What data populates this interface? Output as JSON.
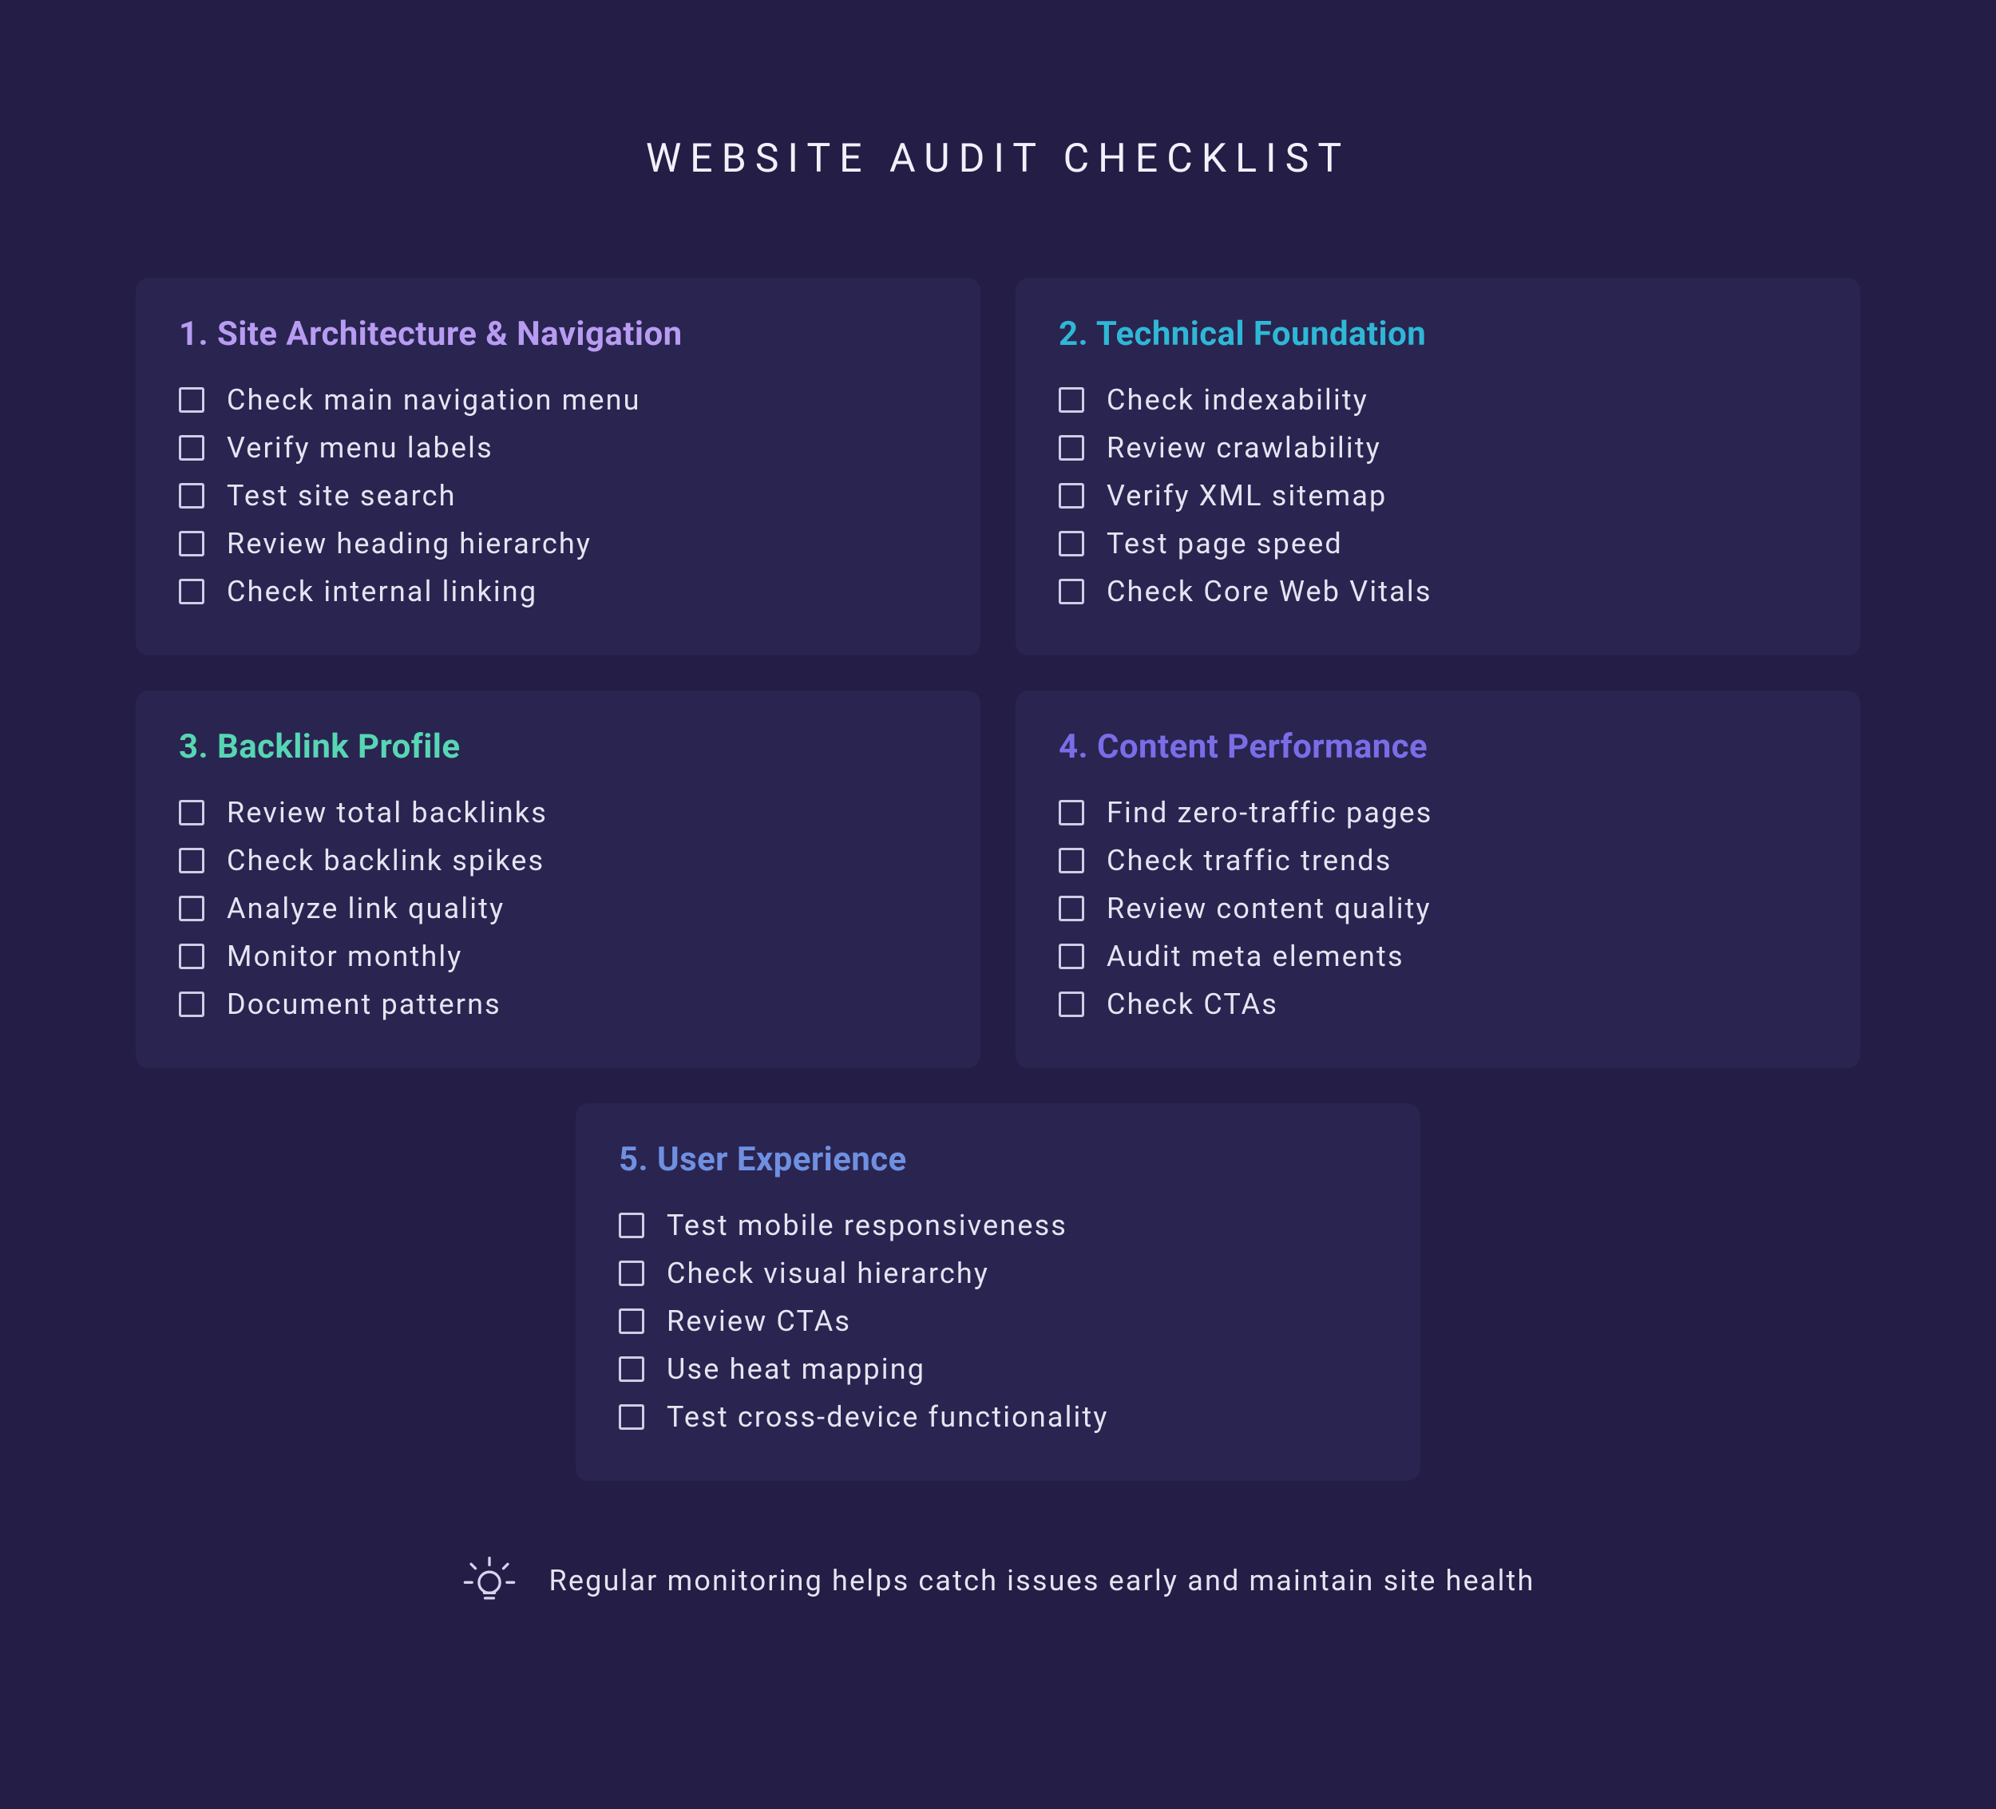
{
  "title": "WEBSITE AUDIT CHECKLIST",
  "sections": [
    {
      "number": "1.",
      "title": "Site Architecture & Navigation",
      "color": "#b79cf2",
      "items": [
        "Check main navigation menu",
        "Verify menu labels",
        "Test site search",
        "Review heading hierarchy",
        "Check internal linking"
      ]
    },
    {
      "number": "2.",
      "title": "Technical Foundation",
      "color": "#2fb7d6",
      "items": [
        "Check indexability",
        "Review crawlability",
        "Verify XML sitemap",
        "Test page speed",
        "Check Core Web Vitals"
      ]
    },
    {
      "number": "3.",
      "title": "Backlink Profile",
      "color": "#57d6b3",
      "items": [
        "Review total backlinks",
        "Check backlink spikes",
        "Analyze link quality",
        "Monitor monthly",
        "Document patterns"
      ]
    },
    {
      "number": "4.",
      "title": "Content Performance",
      "color": "#7a6de8",
      "items": [
        "Find zero-traffic pages",
        "Check traffic trends",
        "Review content quality",
        "Audit meta elements",
        "Check CTAs"
      ]
    },
    {
      "number": "5.",
      "title": "User Experience",
      "color": "#6f90e0",
      "items": [
        "Test mobile responsiveness",
        "Check visual hierarchy",
        "Review CTAs",
        "Use heat mapping",
        "Test cross-device functionality"
      ]
    }
  ],
  "footer": {
    "text": "Regular monitoring helps catch issues early and maintain site health"
  }
}
